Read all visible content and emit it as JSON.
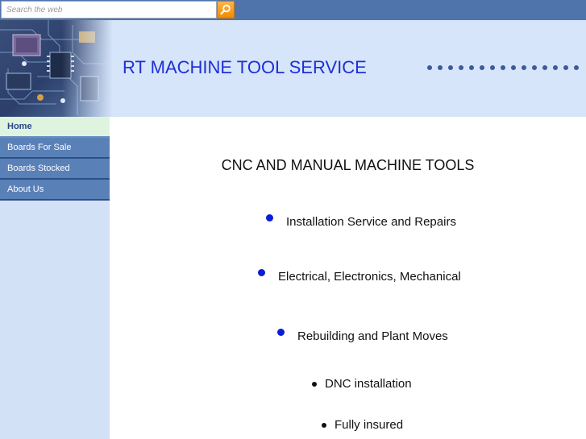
{
  "search": {
    "placeholder": "Search the web"
  },
  "header": {
    "title": "RT MACHINE TOOL SERVICE"
  },
  "nav": {
    "items": [
      {
        "label": "Home"
      },
      {
        "label": "Boards For Sale"
      },
      {
        "label": "Boards Stocked"
      },
      {
        "label": "About Us"
      }
    ]
  },
  "main": {
    "title": "CNC AND MANUAL MACHINE TOOLS",
    "services": [
      "Installation Service and Repairs",
      "Electrical, Electronics, Mechanical",
      "Rebuilding and Plant Moves",
      "DNC installation",
      "Fully insured"
    ]
  },
  "colors": {
    "topbar": "#4f74ab",
    "header_bg": "#d6e5fa",
    "title_blue": "#1f2fd6",
    "nav_bg": "#5a80b8",
    "nav_active_bg": "#def4de",
    "sidebar_bg": "#d3e1f7",
    "search_button": "#f28a00"
  },
  "icons": {
    "search_button": "search-icon",
    "header_image": "circuit-board-image"
  }
}
